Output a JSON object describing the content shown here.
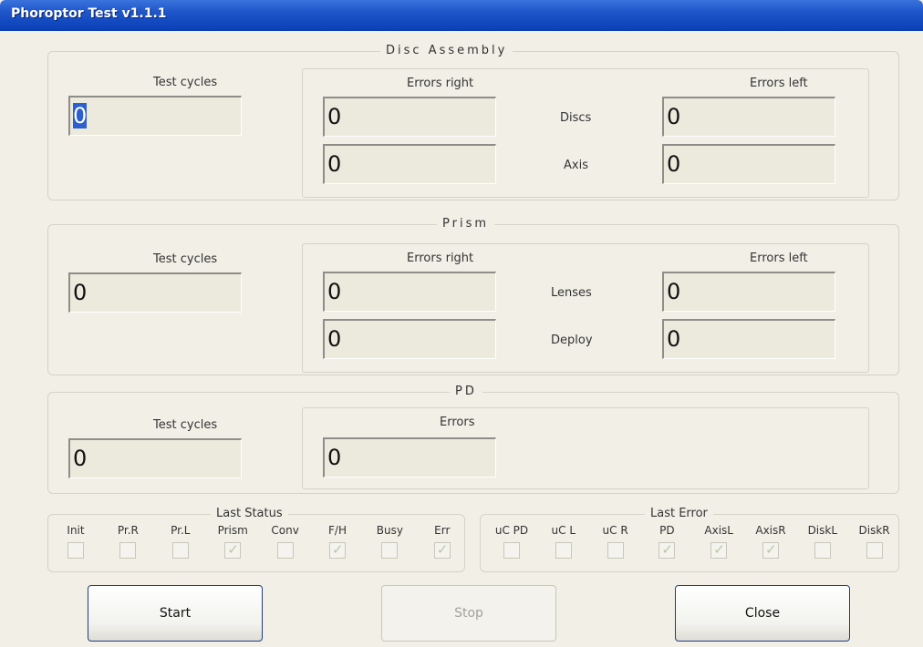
{
  "window": {
    "title": "Phoroptor Test v1.1.1"
  },
  "disc_assembly": {
    "title": "Disc Assembly",
    "test_cycles_label": "Test cycles",
    "test_cycles_value": "0",
    "errors_right_label": "Errors right",
    "errors_left_label": "Errors left",
    "rows": [
      {
        "label": "Discs",
        "right": "0",
        "left": "0"
      },
      {
        "label": "Axis",
        "right": "0",
        "left": "0"
      }
    ]
  },
  "prism": {
    "title": "Prism",
    "test_cycles_label": "Test cycles",
    "test_cycles_value": "0",
    "errors_right_label": "Errors right",
    "errors_left_label": "Errors left",
    "rows": [
      {
        "label": "Lenses",
        "right": "0",
        "left": "0"
      },
      {
        "label": "Deploy",
        "right": "0",
        "left": "0"
      }
    ]
  },
  "pd": {
    "title": "PD",
    "test_cycles_label": "Test cycles",
    "test_cycles_value": "0",
    "errors_label": "Errors",
    "errors_value": "0"
  },
  "last_status": {
    "title": "Last Status",
    "items": [
      {
        "label": "Init",
        "checked": false
      },
      {
        "label": "Pr.R",
        "checked": false
      },
      {
        "label": "Pr.L",
        "checked": false
      },
      {
        "label": "Prism",
        "checked": true
      },
      {
        "label": "Conv",
        "checked": false
      },
      {
        "label": "F/H",
        "checked": true
      },
      {
        "label": "Busy",
        "checked": false
      },
      {
        "label": "Err",
        "checked": true
      }
    ]
  },
  "last_error": {
    "title": "Last Error",
    "items": [
      {
        "label": "uC PD",
        "checked": false
      },
      {
        "label": "uC L",
        "checked": false
      },
      {
        "label": "uC R",
        "checked": false
      },
      {
        "label": "PD",
        "checked": true
      },
      {
        "label": "AxisL",
        "checked": true
      },
      {
        "label": "AxisR",
        "checked": true
      },
      {
        "label": "DiskL",
        "checked": false
      },
      {
        "label": "DiskR",
        "checked": false
      }
    ]
  },
  "buttons": {
    "start": "Start",
    "stop": "Stop",
    "close": "Close"
  }
}
